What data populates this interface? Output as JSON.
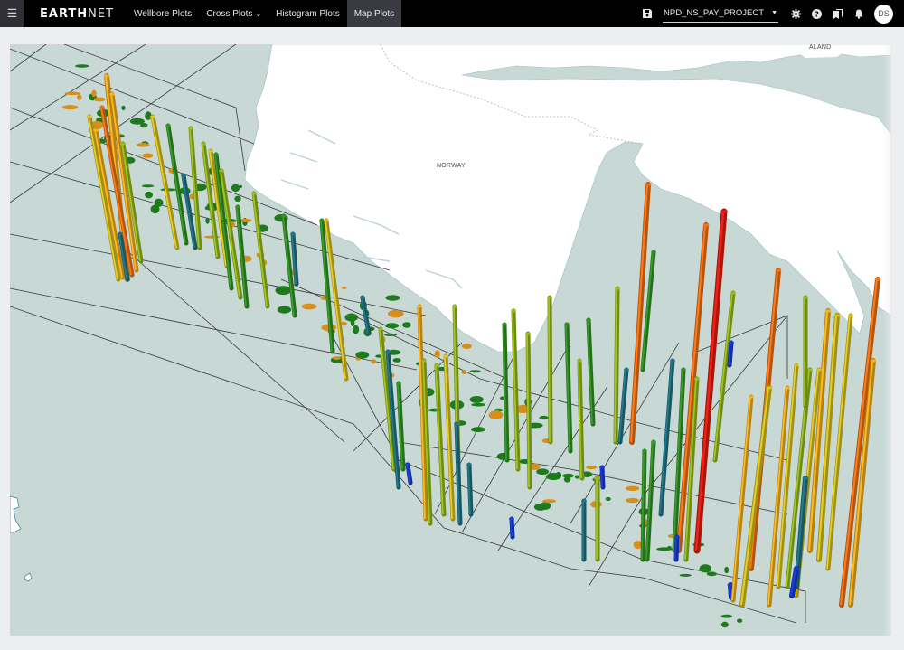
{
  "header": {
    "menu_icon": "hamburger-icon",
    "logo_bold": "EARTH",
    "logo_light": "NET",
    "nav": [
      {
        "label": "Wellbore Plots",
        "active": false,
        "dropdown": false
      },
      {
        "label": "Cross Plots",
        "active": false,
        "dropdown": true
      },
      {
        "label": "Histogram Plots",
        "active": false,
        "dropdown": false
      },
      {
        "label": "Map Plots",
        "active": true,
        "dropdown": false
      }
    ],
    "save_icon": "save-icon",
    "project": "NPD_NS_PAY_PROJECT",
    "settings_icon": "gear-icon",
    "help_icon": "help-icon",
    "bookmarks_icon": "bookmarks-icon",
    "notifications_icon": "bell-icon",
    "avatar_initials": "DS"
  },
  "map": {
    "labels": {
      "country": "NORWAY",
      "region": "ALAND"
    },
    "colors": {
      "sea": "#c7d8d5",
      "land": "#ffffff",
      "coast": "#7aa4b3",
      "grid": "#333333",
      "field_gas": "#1f7a1f",
      "field_oil": "#d68f1c"
    },
    "well_colors": {
      "blue": "#1536c8",
      "teal": "#1d6b7a",
      "green": "#2f8a22",
      "olive": "#8cad1a",
      "yellow": "#c9b31c",
      "amber": "#e2a21c",
      "orange": "#e06a12",
      "red": "#d21c10"
    }
  }
}
